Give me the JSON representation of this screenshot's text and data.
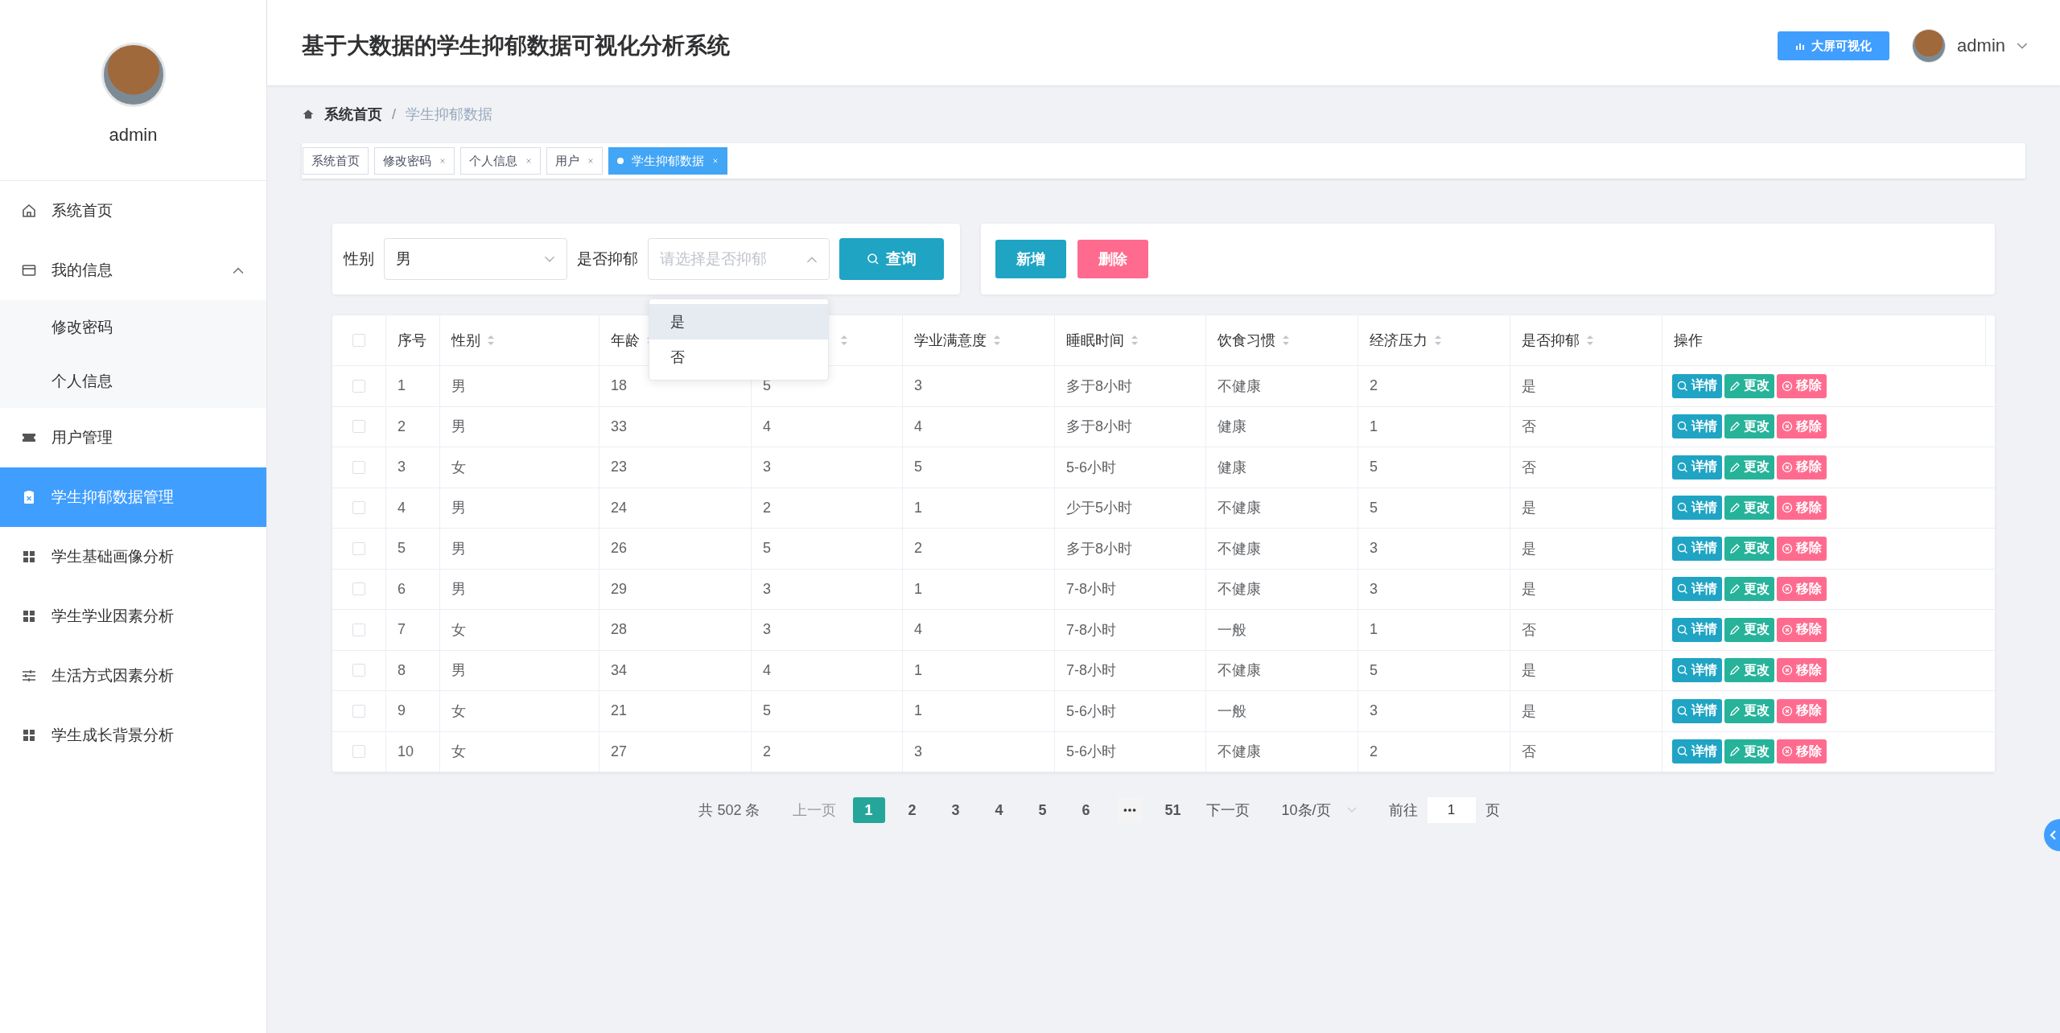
{
  "sidebar": {
    "user_name": "admin",
    "items": [
      {
        "label": "系统首页",
        "kind": "home",
        "selected": false
      },
      {
        "label": "我的信息",
        "kind": "folder",
        "selected": false,
        "expanded": true,
        "children": [
          {
            "label": "修改密码",
            "selected": false
          },
          {
            "label": "个人信息",
            "selected": false
          }
        ]
      },
      {
        "label": "用户管理",
        "kind": "ticket",
        "selected": false
      },
      {
        "label": "学生抑郁数据管理",
        "kind": "clipboard",
        "selected": true
      },
      {
        "label": "学生基础画像分析",
        "kind": "grid",
        "selected": false
      },
      {
        "label": "学生学业因素分析",
        "kind": "grid",
        "selected": false
      },
      {
        "label": "生活方式因素分析",
        "kind": "sliders",
        "selected": false
      },
      {
        "label": "学生成长背景分析",
        "kind": "grid",
        "selected": false
      }
    ]
  },
  "header": {
    "title": "基于大数据的学生抑郁数据可视化分析系统",
    "screen_button": "大屏可视化",
    "user_name": "admin"
  },
  "breadcrumb": {
    "separator": "/",
    "items": [
      "系统首页",
      "学生抑郁数据"
    ]
  },
  "tabs": [
    {
      "label": "系统首页",
      "closable": false,
      "selected": false
    },
    {
      "label": "修改密码",
      "closable": true,
      "selected": false
    },
    {
      "label": "个人信息",
      "closable": true,
      "selected": false
    },
    {
      "label": "用户",
      "closable": true,
      "selected": false
    },
    {
      "label": "学生抑郁数据",
      "closable": true,
      "selected": true
    }
  ],
  "filters": [
    {
      "label": "性别",
      "value": "男",
      "open": false
    },
    {
      "label": "是否抑郁",
      "placeholder": "请选择是否抑郁",
      "open": true,
      "options": [
        {
          "label": "是",
          "highlighted": true
        },
        {
          "label": "否",
          "highlighted": false
        }
      ]
    }
  ],
  "search_button": "查询",
  "actions": [
    {
      "label": "新增",
      "kind": "add"
    },
    {
      "label": "删除",
      "kind": "delete"
    }
  ],
  "table": {
    "all_checked": false,
    "columns": [
      {
        "label": "序号",
        "sortable": false
      },
      {
        "label": "性别",
        "sortable": true
      },
      {
        "label": "年龄",
        "sortable": true
      },
      {
        "sortable": true
      },
      {
        "label": "学业满意度",
        "sortable": true
      },
      {
        "label": "睡眠时间",
        "sortable": true
      },
      {
        "label": "饮食习惯",
        "sortable": true
      },
      {
        "label": "经济压力",
        "sortable": true
      },
      {
        "label": "是否抑郁",
        "sortable": true
      },
      {
        "label": "操作",
        "sortable": false
      }
    ],
    "rows": [
      {
        "checked": false,
        "cells": [
          "1",
          "男",
          "18",
          "5",
          "3",
          "多于8小时",
          "不健康",
          "2",
          "是"
        ],
        "actions": [
          {
            "label": "详情",
            "kind": "detail"
          },
          {
            "label": "更改",
            "kind": "edit"
          },
          {
            "label": "移除",
            "kind": "remove"
          }
        ]
      },
      {
        "checked": false,
        "cells": [
          "2",
          "男",
          "33",
          "4",
          "4",
          "多于8小时",
          "健康",
          "1",
          "否"
        ],
        "actions": [
          {
            "label": "详情",
            "kind": "detail"
          },
          {
            "label": "更改",
            "kind": "edit"
          },
          {
            "label": "移除",
            "kind": "remove"
          }
        ]
      },
      {
        "checked": false,
        "cells": [
          "3",
          "女",
          "23",
          "3",
          "5",
          "5-6小时",
          "健康",
          "5",
          "否"
        ],
        "actions": [
          {
            "label": "详情",
            "kind": "detail"
          },
          {
            "label": "更改",
            "kind": "edit"
          },
          {
            "label": "移除",
            "kind": "remove"
          }
        ]
      },
      {
        "checked": false,
        "cells": [
          "4",
          "男",
          "24",
          "2",
          "1",
          "少于5小时",
          "不健康",
          "5",
          "是"
        ],
        "actions": [
          {
            "label": "详情",
            "kind": "detail"
          },
          {
            "label": "更改",
            "kind": "edit"
          },
          {
            "label": "移除",
            "kind": "remove"
          }
        ]
      },
      {
        "checked": false,
        "cells": [
          "5",
          "男",
          "26",
          "5",
          "2",
          "多于8小时",
          "不健康",
          "3",
          "是"
        ],
        "actions": [
          {
            "label": "详情",
            "kind": "detail"
          },
          {
            "label": "更改",
            "kind": "edit"
          },
          {
            "label": "移除",
            "kind": "remove"
          }
        ]
      },
      {
        "checked": false,
        "cells": [
          "6",
          "男",
          "29",
          "3",
          "1",
          "7-8小时",
          "不健康",
          "3",
          "是"
        ],
        "actions": [
          {
            "label": "详情",
            "kind": "detail"
          },
          {
            "label": "更改",
            "kind": "edit"
          },
          {
            "label": "移除",
            "kind": "remove"
          }
        ]
      },
      {
        "checked": false,
        "cells": [
          "7",
          "女",
          "28",
          "3",
          "4",
          "7-8小时",
          "一般",
          "1",
          "否"
        ],
        "actions": [
          {
            "label": "详情",
            "kind": "detail"
          },
          {
            "label": "更改",
            "kind": "edit"
          },
          {
            "label": "移除",
            "kind": "remove"
          }
        ]
      },
      {
        "checked": false,
        "cells": [
          "8",
          "男",
          "34",
          "4",
          "1",
          "7-8小时",
          "不健康",
          "5",
          "是"
        ],
        "actions": [
          {
            "label": "详情",
            "kind": "detail"
          },
          {
            "label": "更改",
            "kind": "edit"
          },
          {
            "label": "移除",
            "kind": "remove"
          }
        ]
      },
      {
        "checked": false,
        "cells": [
          "9",
          "女",
          "21",
          "5",
          "1",
          "5-6小时",
          "一般",
          "3",
          "是"
        ],
        "actions": [
          {
            "label": "详情",
            "kind": "detail"
          },
          {
            "label": "更改",
            "kind": "edit"
          },
          {
            "label": "移除",
            "kind": "remove"
          }
        ]
      },
      {
        "checked": false,
        "cells": [
          "10",
          "女",
          "27",
          "2",
          "3",
          "5-6小时",
          "不健康",
          "2",
          "否"
        ],
        "actions": [
          {
            "label": "详情",
            "kind": "detail"
          },
          {
            "label": "更改",
            "kind": "edit"
          },
          {
            "label": "移除",
            "kind": "remove"
          }
        ]
      }
    ]
  },
  "pagination": {
    "total": "共 502 条",
    "prev": "上一页",
    "prev_disabled": true,
    "pages": [
      {
        "label": "1",
        "kind": "page",
        "selected": true
      },
      {
        "label": "2",
        "kind": "page",
        "selected": false
      },
      {
        "label": "3",
        "kind": "page",
        "selected": false
      },
      {
        "label": "4",
        "kind": "page",
        "selected": false
      },
      {
        "label": "5",
        "kind": "page",
        "selected": false
      },
      {
        "label": "6",
        "kind": "page",
        "selected": false
      },
      {
        "kind": "more",
        "selected": false
      },
      {
        "label": "51",
        "kind": "page",
        "selected": false
      }
    ],
    "next": "下一页",
    "page_size": "10条/页",
    "jump_label": "前往",
    "jump_value": "1",
    "jump_unit": "页"
  }
}
